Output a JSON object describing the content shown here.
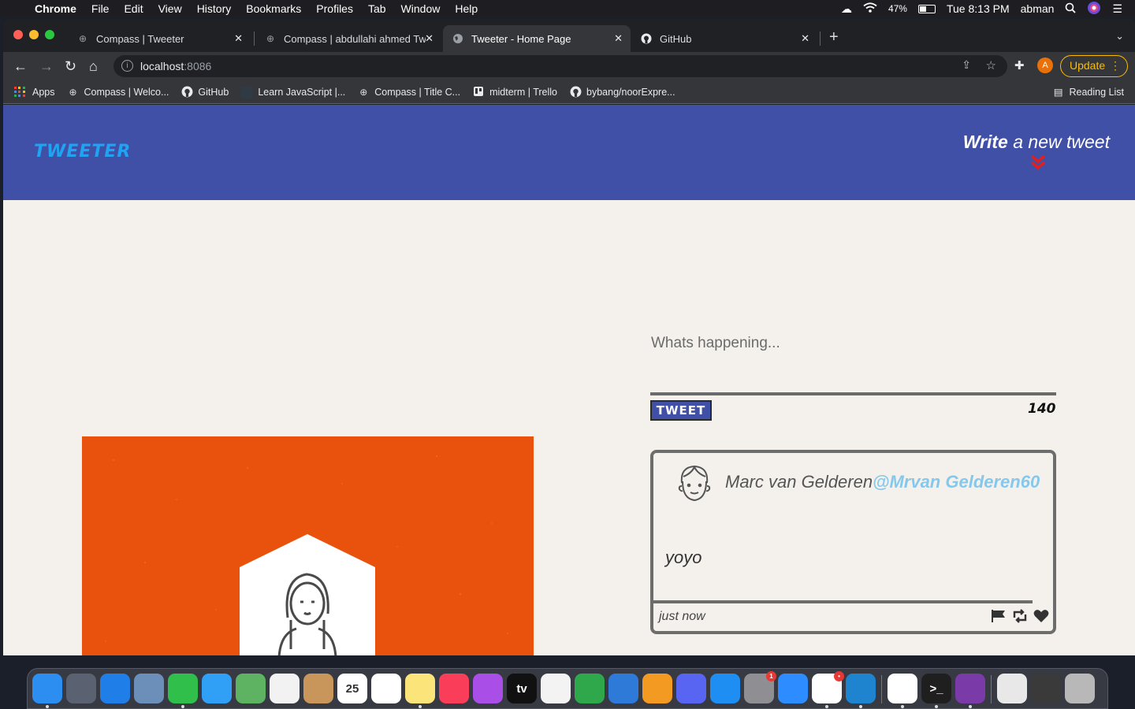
{
  "menubar": {
    "app_name": "Chrome",
    "menus": [
      "File",
      "Edit",
      "View",
      "History",
      "Bookmarks",
      "Profiles",
      "Tab",
      "Window",
      "Help"
    ],
    "battery_percent": "47%",
    "battery_level": 0.47,
    "clock": "Tue 8:13 PM",
    "user": "abman"
  },
  "browser": {
    "tabs": [
      {
        "title": "Compass | Tweeter",
        "icon": "compass-icon"
      },
      {
        "title": "Compass | abdullahi ahmed Tw",
        "icon": "compass-icon"
      },
      {
        "title": "Tweeter - Home Page",
        "icon": "globe-icon",
        "active": true
      },
      {
        "title": "GitHub",
        "icon": "github-icon"
      }
    ],
    "url_host": "localhost",
    "url_port": ":8086",
    "profile_initial": "A",
    "update_label": "Update",
    "bookmarks": [
      {
        "label": "Apps",
        "icon": "apps-grid-icon"
      },
      {
        "label": "Compass | Welco...",
        "icon": "compass-icon"
      },
      {
        "label": "GitHub",
        "icon": "github-icon"
      },
      {
        "label": "Learn JavaScript |...",
        "icon": "blank-favicon"
      },
      {
        "label": "Compass | Title C...",
        "icon": "compass-icon"
      },
      {
        "label": "midterm | Trello",
        "icon": "trello-icon"
      },
      {
        "label": "bybang/noorExpre...",
        "icon": "github-icon"
      }
    ],
    "reading_list_label": "Reading List"
  },
  "page": {
    "logo": "TWEETER",
    "compose": {
      "strong": "Write",
      "rest": " a new tweet"
    },
    "accent_colors": {
      "header": "#4150a7",
      "logo": "#1fa3f2",
      "chevron": "#e0201f",
      "handle": "#86c8ec"
    },
    "composer": {
      "placeholder": "Whats happening...",
      "button_label": "TWEET",
      "counter": "140"
    },
    "tweet": {
      "name": "Marc van Gelderen",
      "handle": "@Mrvan Gelderen60",
      "body": "yoyo",
      "time": "just now",
      "actions": [
        "flag-icon",
        "retweet-icon",
        "heart-icon"
      ]
    }
  },
  "dock": {
    "apps": [
      {
        "name": "finder",
        "color": "#2b8ef0"
      },
      {
        "name": "launchpad",
        "color": "#5a6272"
      },
      {
        "name": "safari",
        "color": "#1f7ee8"
      },
      {
        "name": "preview",
        "color": "#6b8fb8"
      },
      {
        "name": "facetime",
        "color": "#2fbf4a"
      },
      {
        "name": "messages",
        "color": "#2fa0f5"
      },
      {
        "name": "maps",
        "color": "#5db362"
      },
      {
        "name": "photos",
        "color": "#f2f2f2"
      },
      {
        "name": "contacts",
        "color": "#c8955a"
      },
      {
        "name": "calendar",
        "color": "#ffffff",
        "label": "25"
      },
      {
        "name": "reminders",
        "color": "#ffffff"
      },
      {
        "name": "notes",
        "color": "#fbe47a"
      },
      {
        "name": "music",
        "color": "#fa3e5a"
      },
      {
        "name": "podcasts",
        "color": "#a94ee6"
      },
      {
        "name": "apple-tv",
        "color": "#111111",
        "label": "tv"
      },
      {
        "name": "news",
        "color": "#f3f3f3"
      },
      {
        "name": "numbers",
        "color": "#2ea84b"
      },
      {
        "name": "keynote",
        "color": "#2d7ad8"
      },
      {
        "name": "pages",
        "color": "#f39a22"
      },
      {
        "name": "discord",
        "color": "#5865f2"
      },
      {
        "name": "app-store",
        "color": "#1e8ef3"
      },
      {
        "name": "system-preferences",
        "color": "#8e8e93",
        "badge": "1"
      },
      {
        "name": "zoom",
        "color": "#2d8cff"
      },
      {
        "name": "slack",
        "color": "#ffffff",
        "badge": "•"
      },
      {
        "name": "vscode",
        "color": "#1e84cf"
      },
      {
        "name": "chrome",
        "color": "#ffffff"
      },
      {
        "name": "terminal",
        "color": "#1f1f1f",
        "label": ">_"
      },
      {
        "name": "github-desktop",
        "color": "#7a3aa8"
      },
      {
        "name": "documents",
        "color": "#e8e8e8"
      },
      {
        "name": "screenshots",
        "color": "#3a3a3a"
      },
      {
        "name": "trash",
        "color": "#b8b8b8"
      }
    ]
  }
}
